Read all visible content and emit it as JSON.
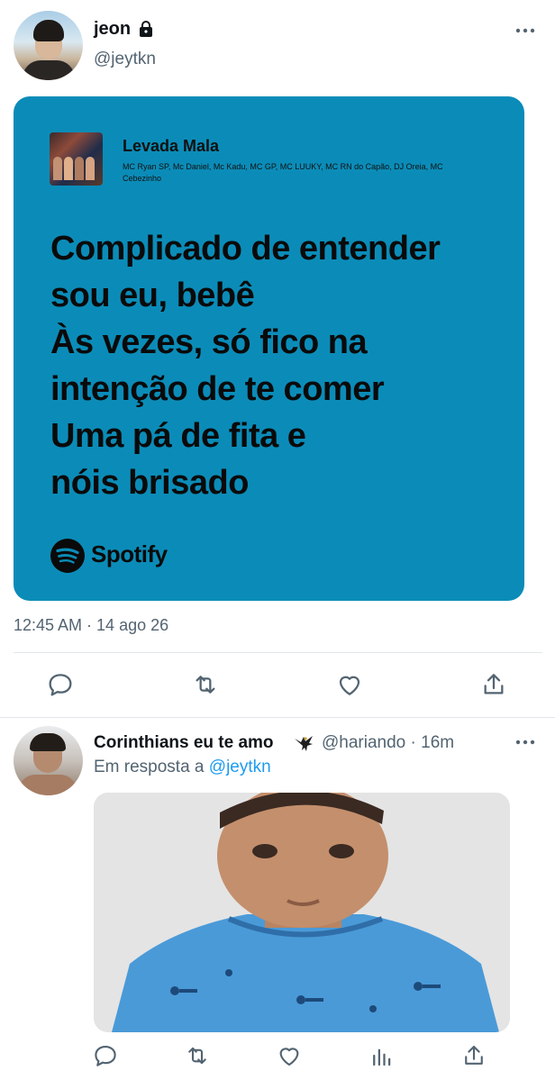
{
  "tweet": {
    "author_name": "jeon",
    "author_handle": "@jeytkn",
    "timestamp": "12:45 AM · 14 ago 26",
    "card": {
      "song_title": "Levada Mala",
      "artists": "MC Ryan SP, Mc Daniel, Mc Kadu, MC GP, MC LUUKY, MC RN do Capão, DJ Oreia, MC Cebezinho",
      "lyrics": [
        "Complicado de entender",
        "sou eu, bebê",
        "Às vezes, só fico na",
        "intenção de te comer",
        "Uma pá de fita e",
        "nóis brisado"
      ],
      "brand": "Spotify",
      "background_color": "#0b8cb8"
    },
    "actions": [
      "reply-icon",
      "retweet-icon",
      "like-icon",
      "share-icon"
    ]
  },
  "reply": {
    "author_name": "Corinthians eu te amo",
    "author_handle": "@hariando · 16m",
    "replying_prefix": "Em resposta a",
    "replying_to": "@jeytkn",
    "actions": [
      "reply-icon",
      "retweet-icon",
      "like-icon",
      "analytics-icon",
      "share-icon"
    ]
  },
  "colors": {
    "secondary_text": "#536471",
    "link": "#1d9bf0",
    "divider": "#e1e6ea",
    "icon": "#536471"
  }
}
